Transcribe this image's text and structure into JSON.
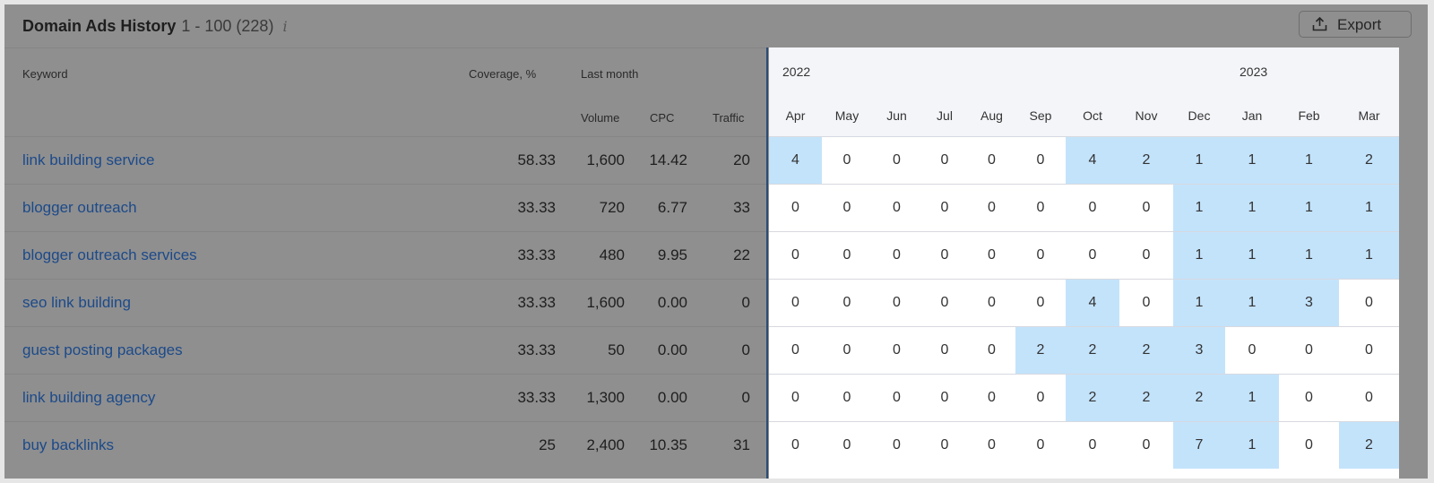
{
  "header": {
    "title": "Domain Ads History",
    "range": "1 - 100 (228)",
    "info_icon": "i",
    "export_label": "Export"
  },
  "columns": {
    "keyword": "Keyword",
    "coverage": "Coverage, %",
    "last_month": "Last month",
    "volume": "Volume",
    "cpc": "CPC",
    "traffic": "Traffic"
  },
  "years": [
    "2022",
    "2023"
  ],
  "months": [
    "Apr",
    "May",
    "Jun",
    "Jul",
    "Aug",
    "Sep",
    "Oct",
    "Nov",
    "Dec",
    "Jan",
    "Feb",
    "Mar"
  ],
  "rows": [
    {
      "keyword": "link building service",
      "coverage": "58.33",
      "volume": "1,600",
      "cpc": "14.42",
      "traffic": "20",
      "history": [
        4,
        0,
        0,
        0,
        0,
        0,
        4,
        2,
        1,
        1,
        1,
        2
      ]
    },
    {
      "keyword": "blogger outreach",
      "coverage": "33.33",
      "volume": "720",
      "cpc": "6.77",
      "traffic": "33",
      "history": [
        0,
        0,
        0,
        0,
        0,
        0,
        0,
        0,
        1,
        1,
        1,
        1
      ]
    },
    {
      "keyword": "blogger outreach services",
      "coverage": "33.33",
      "volume": "480",
      "cpc": "9.95",
      "traffic": "22",
      "history": [
        0,
        0,
        0,
        0,
        0,
        0,
        0,
        0,
        1,
        1,
        1,
        1
      ]
    },
    {
      "keyword": "seo link building",
      "coverage": "33.33",
      "volume": "1,600",
      "cpc": "0.00",
      "traffic": "0",
      "history": [
        0,
        0,
        0,
        0,
        0,
        0,
        4,
        0,
        1,
        1,
        3,
        0
      ]
    },
    {
      "keyword": "guest posting packages",
      "coverage": "33.33",
      "volume": "50",
      "cpc": "0.00",
      "traffic": "0",
      "history": [
        0,
        0,
        0,
        0,
        0,
        2,
        2,
        2,
        3,
        0,
        0,
        0
      ]
    },
    {
      "keyword": "link building agency",
      "coverage": "33.33",
      "volume": "1,300",
      "cpc": "0.00",
      "traffic": "0",
      "history": [
        0,
        0,
        0,
        0,
        0,
        0,
        2,
        2,
        2,
        1,
        0,
        0
      ]
    },
    {
      "keyword": "buy backlinks",
      "coverage": "25",
      "volume": "2,400",
      "cpc": "10.35",
      "traffic": "31",
      "history": [
        0,
        0,
        0,
        0,
        0,
        0,
        0,
        0,
        7,
        1,
        0,
        2
      ]
    }
  ],
  "colors": {
    "highlight": "#c3e3fb",
    "link": "#1c4a8a",
    "overlay": "#8f8f8f"
  }
}
